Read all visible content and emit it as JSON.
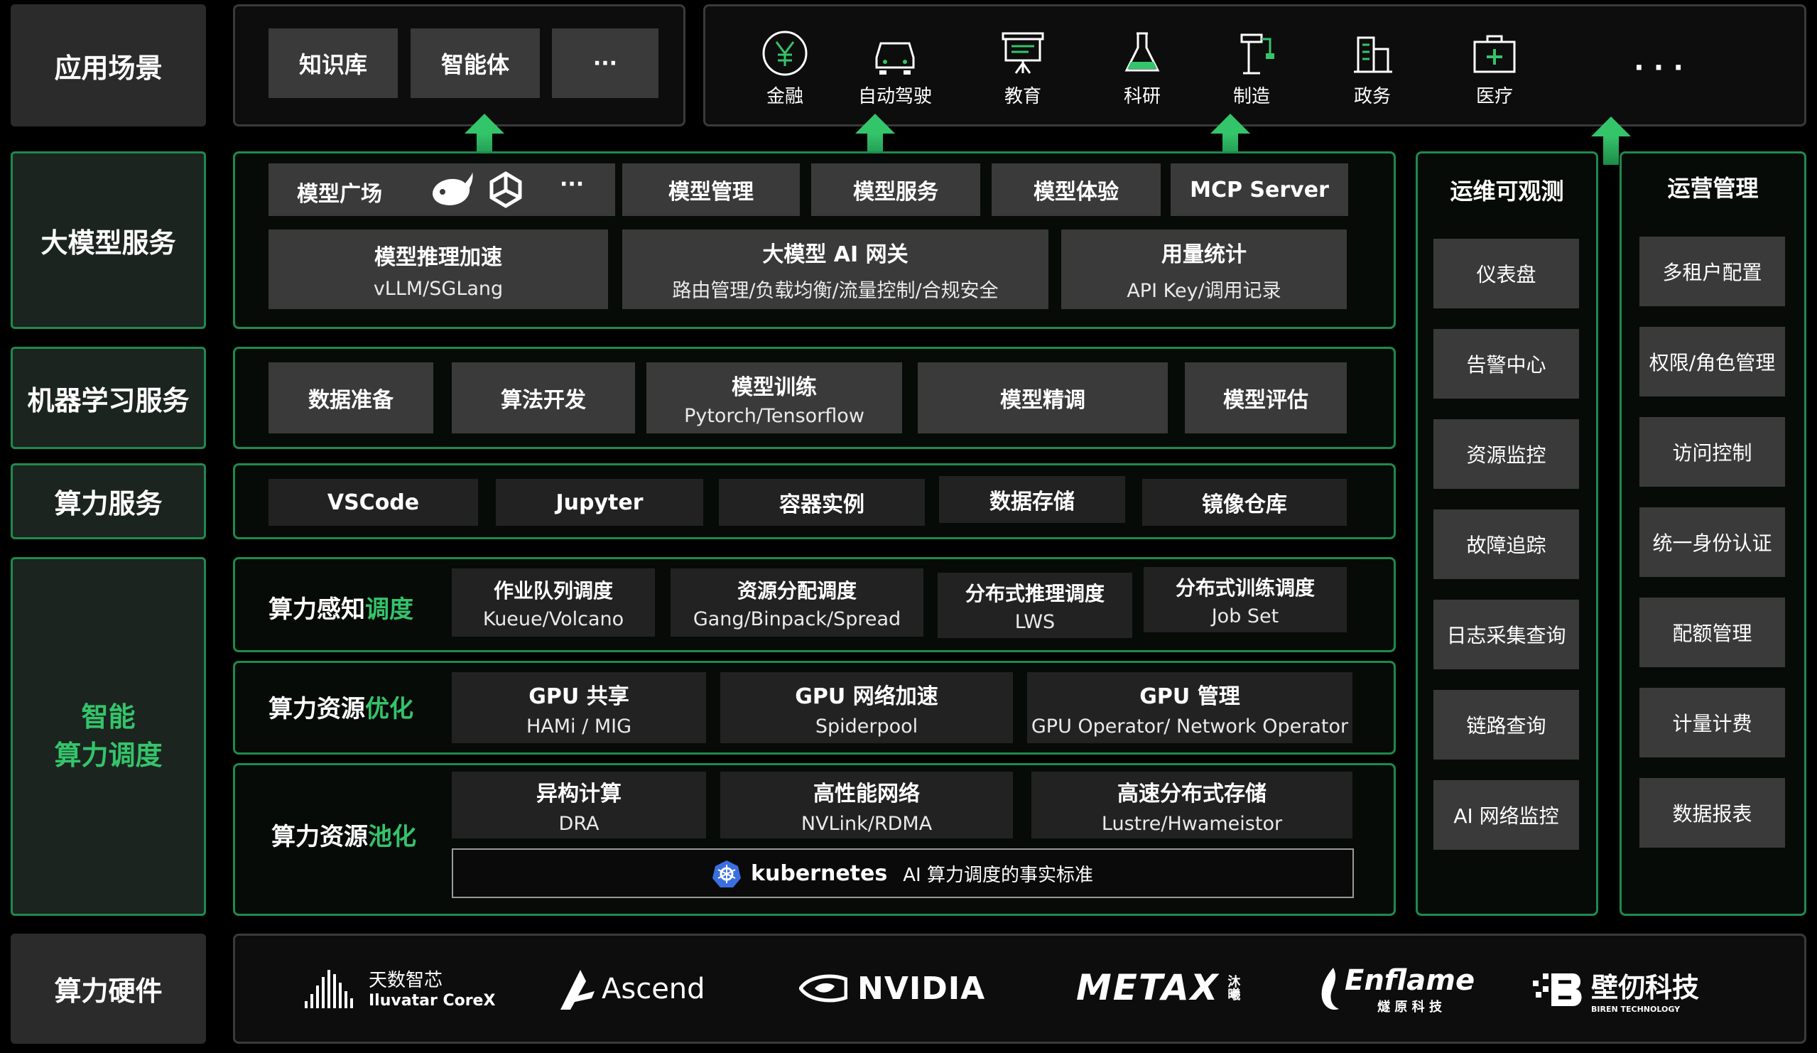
{
  "rows": {
    "app": "应用场景",
    "llm": "大模型服务",
    "ml": "机器学习服务",
    "compute": "算力服务",
    "smart_line1": "智能",
    "smart_line2": "算力调度",
    "hardware": "算力硬件"
  },
  "apps": {
    "kb": "知识库",
    "agent": "智能体",
    "more": "···",
    "scenes": [
      {
        "label": "金融",
        "icon": "yuan-circle-icon"
      },
      {
        "label": "自动驾驶",
        "icon": "car-icon"
      },
      {
        "label": "教育",
        "icon": "presentation-board-icon"
      },
      {
        "label": "科研",
        "icon": "flask-icon"
      },
      {
        "label": "制造",
        "icon": "crane-icon"
      },
      {
        "label": "政务",
        "icon": "government-building-icon"
      },
      {
        "label": "医疗",
        "icon": "medical-kit-icon"
      }
    ],
    "scenes_more": "· · ·"
  },
  "llm": {
    "square": "模型广场",
    "square_more": "···",
    "manage": "模型管理",
    "service": "模型服务",
    "experience": "模型体验",
    "mcp": "MCP Server",
    "infer_title": "模型推理加速",
    "infer_sub": "vLLM/SGLang",
    "gateway_title": "大模型 AI 网关",
    "gateway_sub": "路由管理/负载均衡/流量控制/合规安全",
    "usage_title": "用量统计",
    "usage_sub": "API Key/调用记录"
  },
  "ml": {
    "data_prep": "数据准备",
    "algo_dev": "算法开发",
    "train_title": "模型训练",
    "train_sub": "Pytorch/Tensorflow",
    "finetune": "模型精调",
    "eval": "模型评估"
  },
  "compute": {
    "vscode": "VSCode",
    "jupyter": "Jupyter",
    "container": "容器实例",
    "storage": "数据存储",
    "registry": "镜像仓库"
  },
  "sched": {
    "label_plain": "算力感知",
    "label_accent": "调度",
    "queue_title": "作业队列调度",
    "queue_sub": "Kueue/Volcano",
    "alloc_title": "资源分配调度",
    "alloc_sub": "Gang/Binpack/Spread",
    "dinfer_title": "分布式推理调度",
    "dinfer_sub": "LWS",
    "dtrain_title": "分布式训练调度",
    "dtrain_sub": "Job Set"
  },
  "opt": {
    "label_plain": "算力资源",
    "label_accent": "优化",
    "share_title": "GPU 共享",
    "share_sub": "HAMi / MIG",
    "net_title": "GPU 网络加速",
    "net_sub": "Spiderpool",
    "mgmt_title": "GPU 管理",
    "mgmt_sub": "GPU Operator/ Network Operator"
  },
  "pool": {
    "label_plain": "算力资源",
    "label_accent": "池化",
    "hetero_title": "异构计算",
    "hetero_sub": "DRA",
    "hpn_title": "高性能网络",
    "hpn_sub": "NVLink/RDMA",
    "hsstore_title": "高速分布式存储",
    "hsstore_sub": "Lustre/Hwameistor",
    "k8s_name": "kubernetes",
    "k8s_desc": "AI 算力调度的事实标准"
  },
  "ops": {
    "title": "运维可观测",
    "items": [
      "仪表盘",
      "告警中心",
      "资源监控",
      "故障追踪",
      "日志采集查询",
      "链路查询",
      "AI 网络监控"
    ]
  },
  "operate": {
    "title": "运营管理",
    "items": [
      "多租户配置",
      "权限/角色管理",
      "访问控制",
      "统一身份认证",
      "配额管理",
      "计量计费",
      "数据报表"
    ]
  },
  "hardware": {
    "iluvatar_cn": "天数智芯",
    "iluvatar_en": "Iluvatar CoreX",
    "ascend": "Ascend",
    "nvidia": "NVIDIA",
    "metax": "METAX",
    "metax_cn": "沐曦",
    "enflame": "Enflame",
    "enflame_cn": "燧 原 科 技",
    "biren_cn": "壁仞科技",
    "biren_en": "BIREN TECHNOLOGY"
  }
}
